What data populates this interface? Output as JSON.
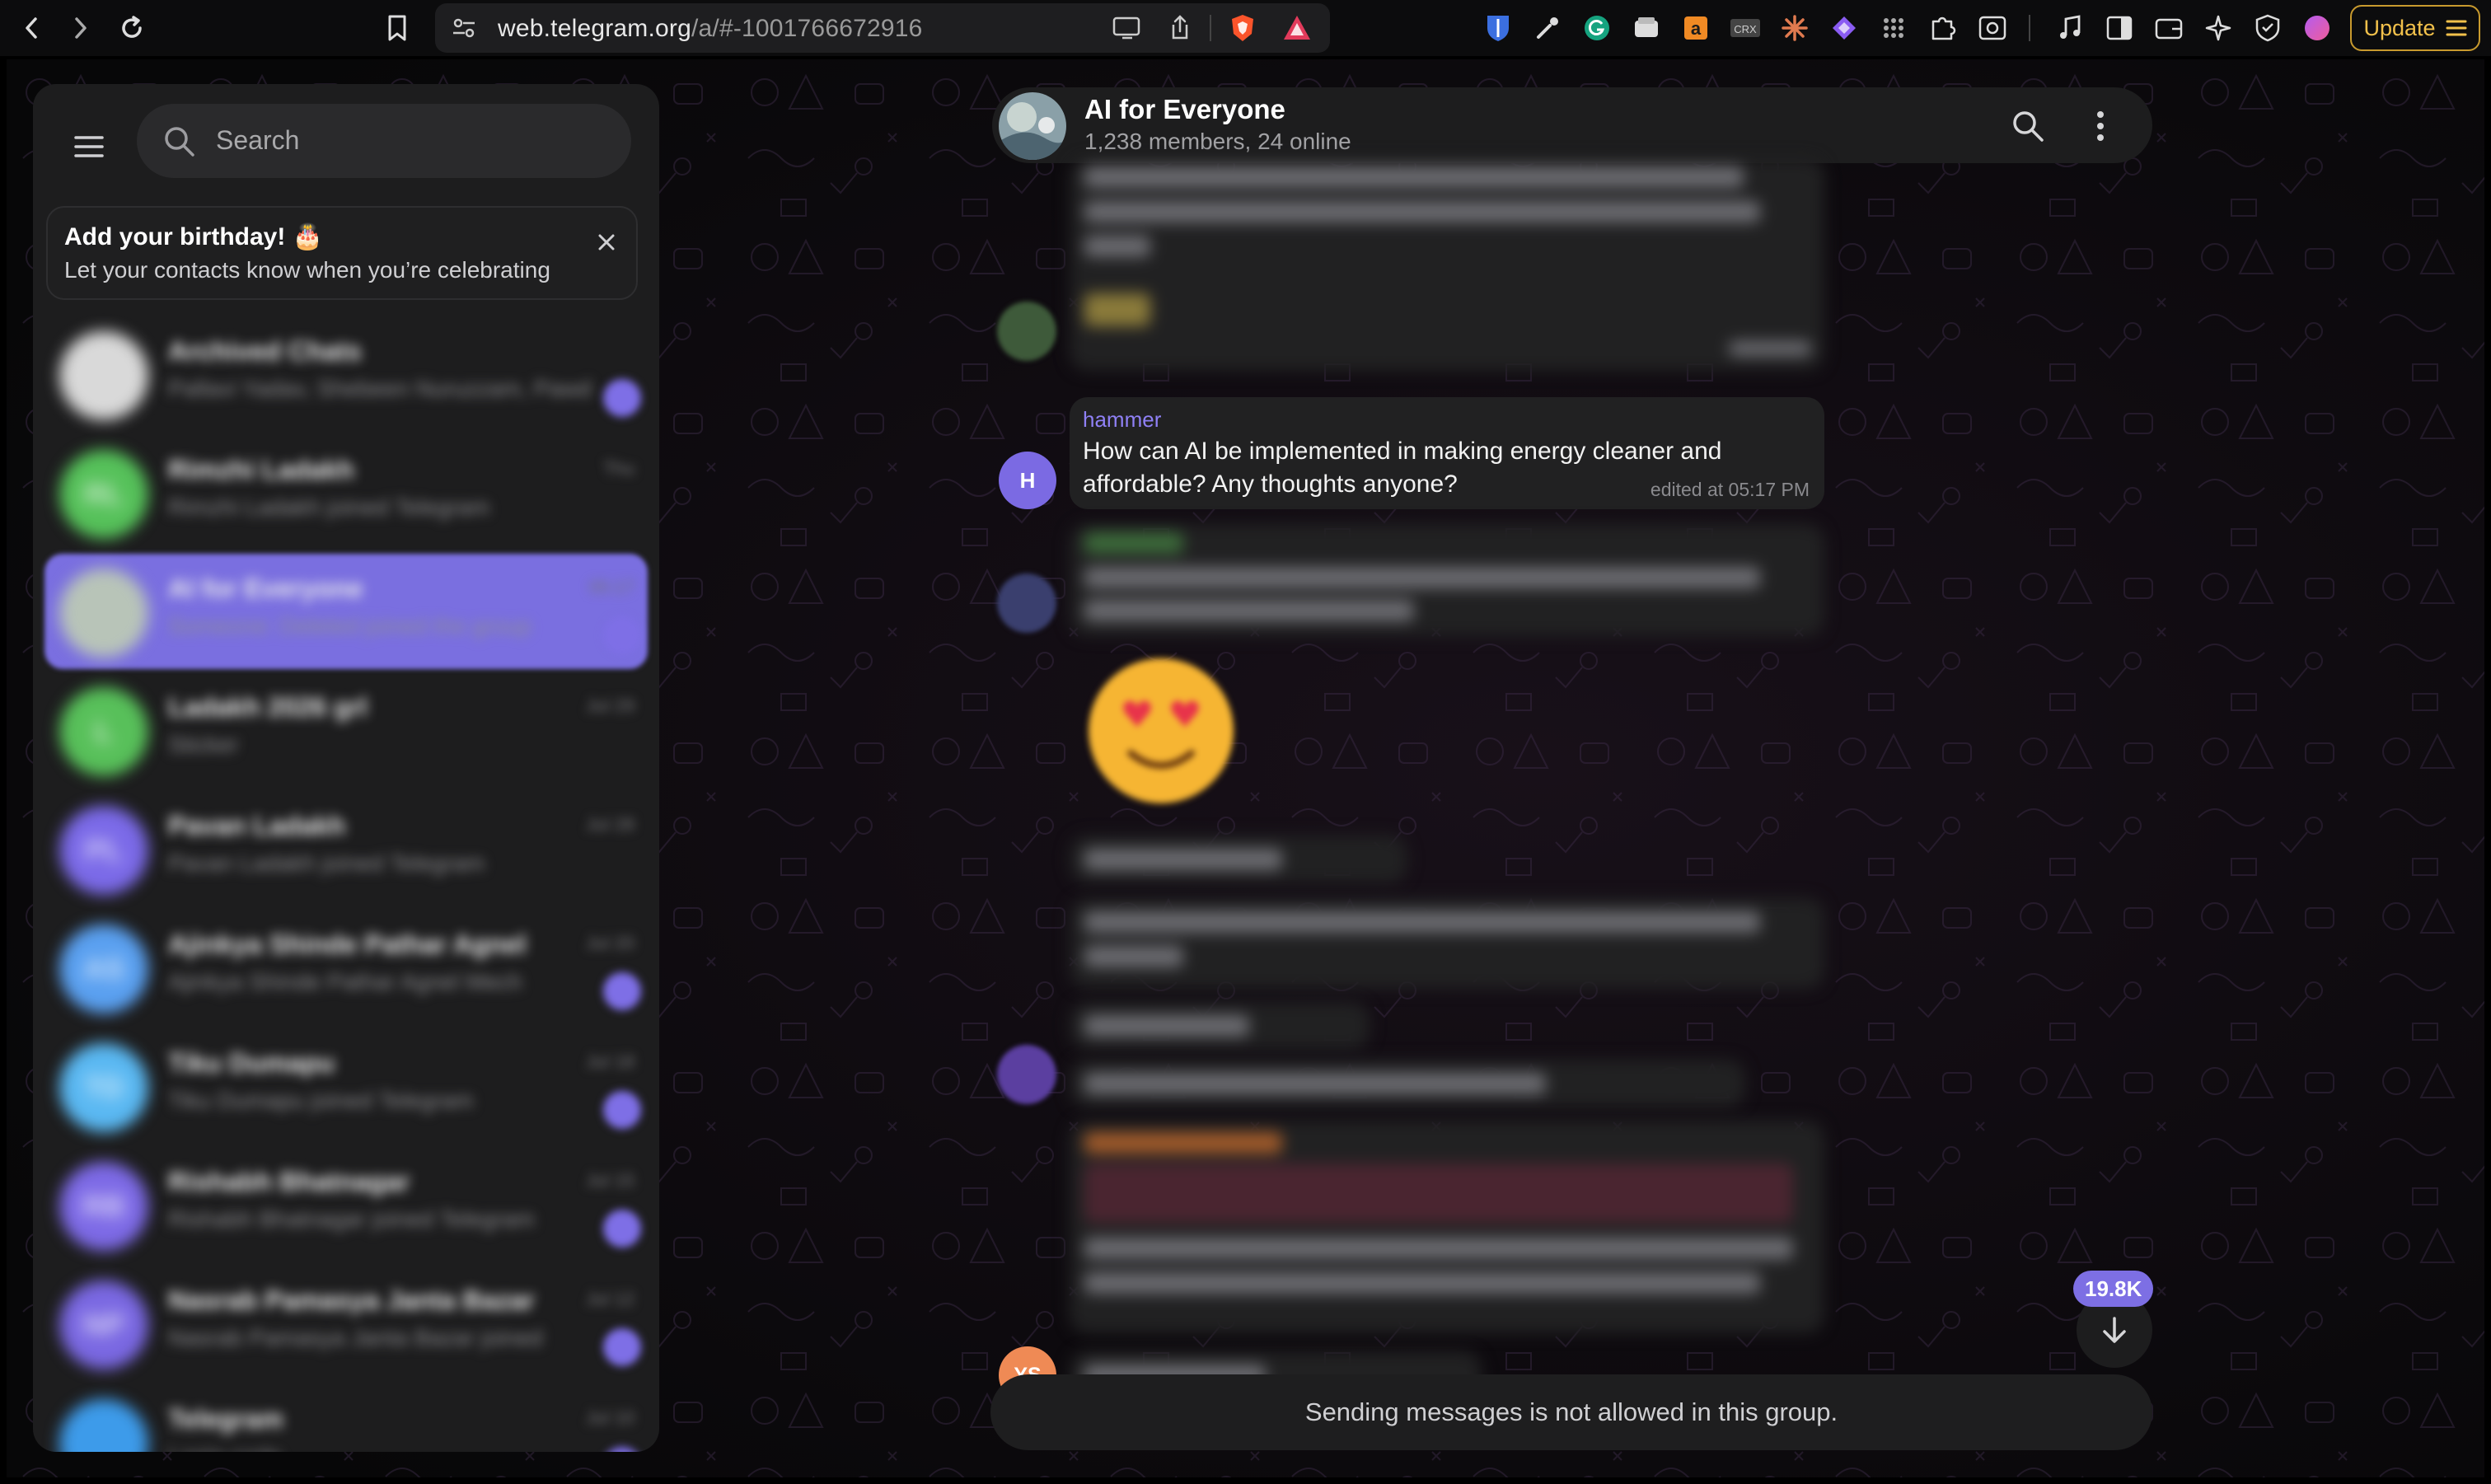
{
  "browser": {
    "url_host": "web.telegram.org",
    "url_path": "/a/#-1001766672916",
    "update_label": "Update"
  },
  "sidebar": {
    "search_placeholder": "Search",
    "birthday_card": {
      "title": "Add your birthday! 🎂",
      "subtitle": "Let your contacts know when you’re celebrating"
    },
    "chats": [
      {
        "name": "Archived Chats",
        "preview": "Pallavi Yadav, Shebeen Nuruzzam, Pawd",
        "avatar_color": "#d9d9d9",
        "initials": "",
        "time": "",
        "badge": true,
        "active": false
      },
      {
        "name": "Rimzhi Ladakh",
        "preview": "Rimzhi Ladakh joined Telegram",
        "avatar_color": "#56c15a",
        "initials": "RL",
        "time": "Thu",
        "badge": false,
        "active": false
      },
      {
        "name": "AI for Everyone",
        "preview": "Someone: Deleted joined the group",
        "avatar_color": "#b8c4b8",
        "initials": "",
        "time": "05:17",
        "badge": true,
        "active": true
      },
      {
        "name": "Ladakh 2026 grl",
        "preview": "Sticker",
        "avatar_color": "#58c05a",
        "initials": "L",
        "time": "Jul 29",
        "badge": false,
        "active": false
      },
      {
        "name": "Pavan Ladakh",
        "preview": "Pavan Ladakh joined Telegram",
        "avatar_color": "#7b6ae8",
        "initials": "PL",
        "time": "Jul 28",
        "badge": false,
        "active": false
      },
      {
        "name": "Ajinkya Shinde Pathar Agnel",
        "preview": "Ajinkya Shinde Pathar Agnel Mech",
        "avatar_color": "#5aa0f0",
        "initials": "AS",
        "time": "Jul 20",
        "badge": true,
        "active": false
      },
      {
        "name": "Tiku Dumapu",
        "preview": "Tiku Dumapu joined Telegram",
        "avatar_color": "#5ab8f2",
        "initials": "TD",
        "time": "Jul 18",
        "badge": true,
        "active": false
      },
      {
        "name": "Rishabh Bhatnagar",
        "preview": "Rishabh Bhatnagar joined Telegram",
        "avatar_color": "#7d6ae6",
        "initials": "RB",
        "time": "Jul 15",
        "badge": true,
        "active": false
      },
      {
        "name": "Nasrab Pamasya Janta Bazar",
        "preview": "Nasrab Pamasya Janta Bazar joined",
        "avatar_color": "#7a68e2",
        "initials": "NP",
        "time": "Jul 12",
        "badge": true,
        "active": false
      },
      {
        "name": "Telegram",
        "preview": "Login code",
        "avatar_color": "#3d9bea",
        "initials": "",
        "time": "Jul 10",
        "badge": true,
        "active": false
      }
    ]
  },
  "chat": {
    "title": "AI for Everyone",
    "subtitle": "1,238 members, 24 online",
    "message": {
      "sender": "hammer",
      "avatar_initial": "H",
      "text": "How can AI be implemented in making energy cleaner and affordable? Any thoughts anyone?",
      "meta": "edited at 05:17 PM"
    },
    "ys_initials": "YS",
    "unread_count": "19.8K",
    "footer_notice": "Sending messages is not allowed in this group."
  },
  "colors": {
    "accent": "#7b6ae3",
    "bubble": "#212122",
    "panel": "#1d1d1e"
  }
}
